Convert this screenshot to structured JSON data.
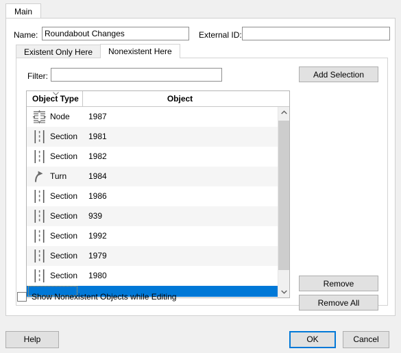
{
  "window": {
    "outer_tabs": [
      {
        "label": "Main",
        "active": true
      }
    ]
  },
  "fields": {
    "name_label": "Name:",
    "name_value": "Roundabout Changes",
    "name_placeholder": "",
    "external_id_label": "External ID:",
    "external_id_value": "",
    "external_id_placeholder": ""
  },
  "inner_tabs": [
    {
      "label": "Existent Only Here",
      "active": false
    },
    {
      "label": "Nonexistent Here",
      "active": true
    }
  ],
  "panel": {
    "filter_label": "Filter:",
    "filter_value": "",
    "filter_placeholder": "",
    "add_selection_label": "Add Selection",
    "remove_label": "Remove",
    "remove_all_label": "Remove All"
  },
  "table": {
    "columns": [
      {
        "key": "object_type",
        "label": "Object Type",
        "sorted": true,
        "sort_direction": "down"
      },
      {
        "key": "object",
        "label": "Object",
        "sorted": false
      }
    ],
    "rows": [
      {
        "icon": "node-icon",
        "object_type": "Node",
        "object": "1987",
        "selected": false
      },
      {
        "icon": "section-icon",
        "object_type": "Section",
        "object": "1981",
        "selected": false
      },
      {
        "icon": "section-icon",
        "object_type": "Section",
        "object": "1982",
        "selected": false
      },
      {
        "icon": "turn-icon",
        "object_type": "Turn",
        "object": "1984",
        "selected": false
      },
      {
        "icon": "section-icon",
        "object_type": "Section",
        "object": "1986",
        "selected": false
      },
      {
        "icon": "section-icon",
        "object_type": "Section",
        "object": "939",
        "selected": false
      },
      {
        "icon": "section-icon",
        "object_type": "Section",
        "object": "1992",
        "selected": false
      },
      {
        "icon": "section-icon",
        "object_type": "Section",
        "object": "1979",
        "selected": false
      },
      {
        "icon": "section-icon",
        "object_type": "Section",
        "object": "1980",
        "selected": false
      },
      {
        "icon": "",
        "object_type": "",
        "object": "",
        "selected": true
      }
    ]
  },
  "options": {
    "show_nonexistent_label": "Show Nonexistent Objects while Editing",
    "show_nonexistent_checked": false
  },
  "footer": {
    "help_label": "Help",
    "ok_label": "OK",
    "cancel_label": "Cancel"
  },
  "colors": {
    "accent": "#0078d7",
    "dialog_bg": "#f0f0f0",
    "panel_bg": "#ffffff",
    "row_alt": "#f5f5f5",
    "focus_rect": "#f0a030",
    "button_face": "#e1e1e1"
  }
}
